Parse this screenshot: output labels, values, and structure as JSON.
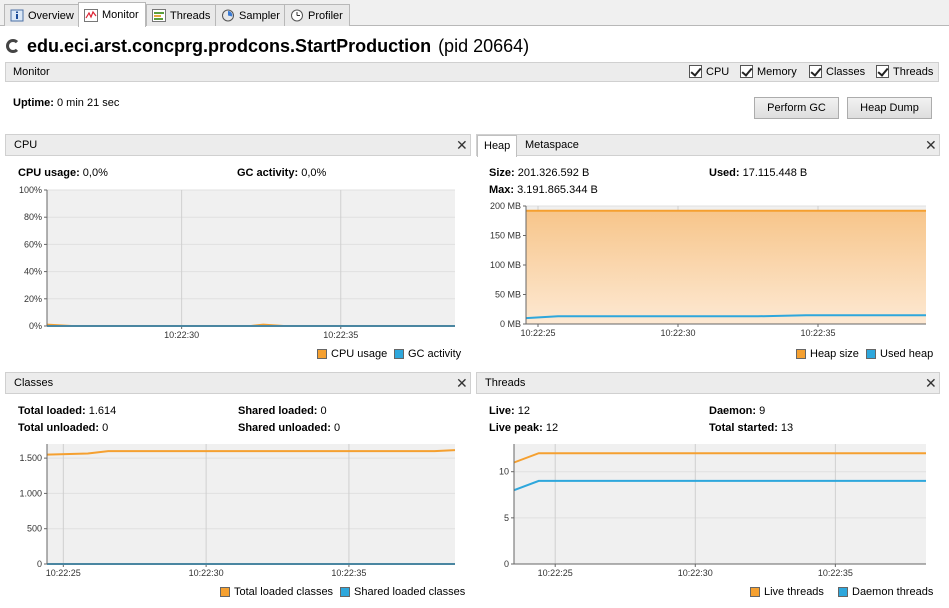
{
  "tabs": [
    {
      "label": "Overview",
      "icon": "info-icon"
    },
    {
      "label": "Monitor",
      "icon": "monitor-chart-icon"
    },
    {
      "label": "Threads",
      "icon": "threads-icon"
    },
    {
      "label": "Sampler",
      "icon": "sampler-icon"
    },
    {
      "label": "Profiler",
      "icon": "profiler-clock-icon"
    }
  ],
  "app": {
    "name": "edu.eci.arst.concprg.prodcons.StartProduction",
    "pid": "(pid 20664)"
  },
  "monitor": {
    "label": "Monitor",
    "checkboxes": [
      {
        "label": "CPU",
        "checked": true
      },
      {
        "label": "Memory",
        "checked": true
      },
      {
        "label": "Classes",
        "checked": true
      },
      {
        "label": "Threads",
        "checked": true
      }
    ],
    "uptime_label": "Uptime:",
    "uptime_value": " 0 min 21 sec",
    "perform_gc": "Perform GC",
    "heap_dump": "Heap Dump"
  },
  "colors": {
    "orange": "#f5a030",
    "blue": "#2ea7dc",
    "orange_fill": "#fbd9ad"
  },
  "cpu": {
    "title": "CPU",
    "usage_label": "CPU usage:",
    "usage_value": " 0,0%",
    "gc_label": "GC activity:",
    "gc_value": " 0,0%",
    "legend": [
      "CPU usage",
      "GC activity"
    ]
  },
  "heap": {
    "tabs": [
      "Heap",
      "Metaspace"
    ],
    "size_label": "Size:",
    "size_value": " 201.326.592 B",
    "used_label": "Used:",
    "used_value": " 17.115.448 B",
    "max_label": "Max:",
    "max_value": " 3.191.865.344 B",
    "legend": [
      "Heap size",
      "Used heap"
    ]
  },
  "classes": {
    "title": "Classes",
    "total_loaded_label": "Total loaded:",
    "total_loaded_value": " 1.614",
    "total_unloaded_label": "Total unloaded:",
    "total_unloaded_value": " 0",
    "shared_loaded_label": "Shared loaded:",
    "shared_loaded_value": " 0",
    "shared_unloaded_label": "Shared unloaded:",
    "shared_unloaded_value": " 0",
    "legend": [
      "Total loaded classes",
      "Shared loaded classes"
    ]
  },
  "threads": {
    "title": "Threads",
    "live_label": "Live:",
    "live_value": " 12",
    "live_peak_label": "Live peak:",
    "live_peak_value": " 12",
    "daemon_label": "Daemon:",
    "daemon_value": " 9",
    "total_started_label": "Total started:",
    "total_started_value": " 13",
    "legend": [
      "Live threads",
      "Daemon threads"
    ]
  },
  "chart_data": [
    {
      "type": "line",
      "name": "CPU",
      "ylim": [
        0,
        100
      ],
      "yticks": [
        "0%",
        "20%",
        "40%",
        "60%",
        "80%",
        "100%"
      ],
      "xticks": [
        "10:22:30",
        "10:22:35"
      ],
      "series": [
        {
          "name": "CPU usage",
          "points": [
            [
              0,
              1
            ],
            [
              0.06,
              0
            ],
            [
              0.5,
              0
            ],
            [
              0.53,
              1
            ],
            [
              0.58,
              0
            ],
            [
              1,
              0
            ]
          ]
        },
        {
          "name": "GC activity",
          "points": [
            [
              0,
              0
            ],
            [
              1,
              0
            ]
          ]
        }
      ]
    },
    {
      "type": "area",
      "name": "Heap",
      "ylim": [
        0,
        200
      ],
      "yticks": [
        "0 MB",
        "50 MB",
        "100 MB",
        "150 MB",
        "200 MB"
      ],
      "xticks": [
        "10:22:25",
        "10:22:30",
        "10:22:35"
      ],
      "series": [
        {
          "name": "Heap size",
          "points": [
            [
              0,
              192
            ],
            [
              1,
              192
            ]
          ]
        },
        {
          "name": "Used heap",
          "points": [
            [
              0,
              10
            ],
            [
              0.08,
              13
            ],
            [
              0.58,
              13
            ],
            [
              0.7,
              15
            ],
            [
              1,
              15
            ]
          ]
        }
      ]
    },
    {
      "type": "line",
      "name": "Classes",
      "ylim": [
        0,
        1700
      ],
      "yticks": [
        "0",
        "500",
        "1.000",
        "1.500"
      ],
      "xticks": [
        "10:22:25",
        "10:22:30",
        "10:22:35"
      ],
      "series": [
        {
          "name": "Total loaded classes",
          "points": [
            [
              0,
              1550
            ],
            [
              0.1,
              1565
            ],
            [
              0.15,
              1600
            ],
            [
              0.95,
              1600
            ],
            [
              1,
              1614
            ]
          ]
        },
        {
          "name": "Shared loaded classes",
          "points": [
            [
              0,
              0
            ],
            [
              1,
              0
            ]
          ]
        }
      ]
    },
    {
      "type": "line",
      "name": "Threads",
      "ylim": [
        0,
        13
      ],
      "yticks": [
        "0",
        "5",
        "10"
      ],
      "xticks": [
        "10:22:25",
        "10:22:30",
        "10:22:35"
      ],
      "series": [
        {
          "name": "Live threads",
          "points": [
            [
              0,
              11
            ],
            [
              0.06,
              12
            ],
            [
              1,
              12
            ]
          ]
        },
        {
          "name": "Daemon threads",
          "points": [
            [
              0,
              8
            ],
            [
              0.06,
              9
            ],
            [
              1,
              9
            ]
          ]
        }
      ]
    }
  ]
}
